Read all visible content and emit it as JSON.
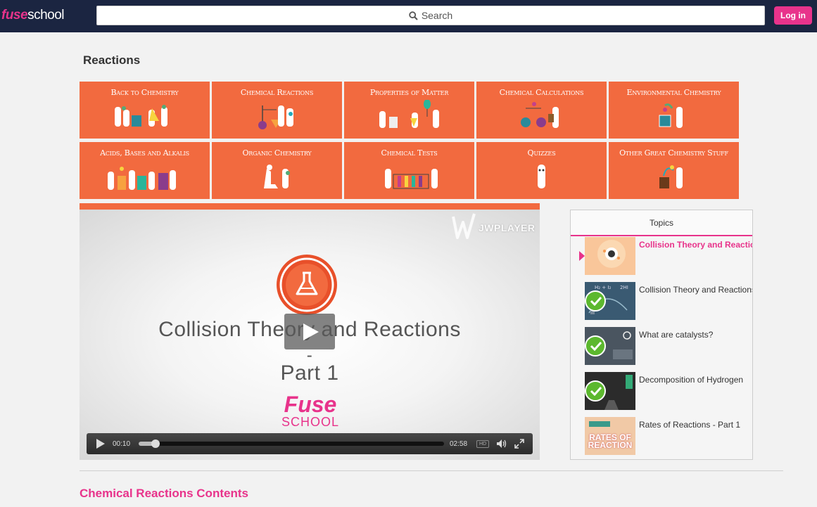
{
  "header": {
    "logo_fuse": "fuse",
    "logo_school": "school",
    "search_label": "Search",
    "login_label": "Log in"
  },
  "page": {
    "title": "Reactions"
  },
  "categories": [
    {
      "label": "Back to Chemistry"
    },
    {
      "label": "Chemical Reactions"
    },
    {
      "label": "Properties of Matter"
    },
    {
      "label": "Chemical Calculations"
    },
    {
      "label": "Environmental Chemistry"
    },
    {
      "label": "Acids, Bases and Alkalis"
    },
    {
      "label": "Organic Chemistry"
    },
    {
      "label": "Chemical Tests"
    },
    {
      "label": "Quizzes"
    },
    {
      "label": "Other Great Chemistry Stuff"
    }
  ],
  "video": {
    "watermark": "JWPLAYER",
    "title_line1": "Collision Theory and Reactions",
    "title_line2": "-",
    "title_line3": "Part 1",
    "brand_top": "Fuse",
    "brand_bottom": "SCHOOL",
    "elapsed": "00:10",
    "duration": "02:58",
    "progress": 0.056,
    "hd_label": "HD"
  },
  "topics": {
    "header": "Topics",
    "items": [
      {
        "title": "Collision Theory and Reactions",
        "active": true,
        "watched": false
      },
      {
        "title": "Collision Theory and Reactions",
        "active": false,
        "watched": true
      },
      {
        "title": "What are catalysts?",
        "active": false,
        "watched": true
      },
      {
        "title": "Decomposition of Hydrogen",
        "active": false,
        "watched": true
      },
      {
        "title": "Rates of Reactions - Part 1",
        "active": false,
        "watched": false
      }
    ],
    "thumb5_text_line1": "RATES OF",
    "thumb5_text_line2": "REACTION"
  },
  "footer": {
    "contents_title": "Chemical Reactions Contents"
  },
  "colors": {
    "brand_pink": "#e8338b",
    "tile_orange": "#f26a3f",
    "header_navy": "#1b2541",
    "check_green": "#5cb82e"
  }
}
